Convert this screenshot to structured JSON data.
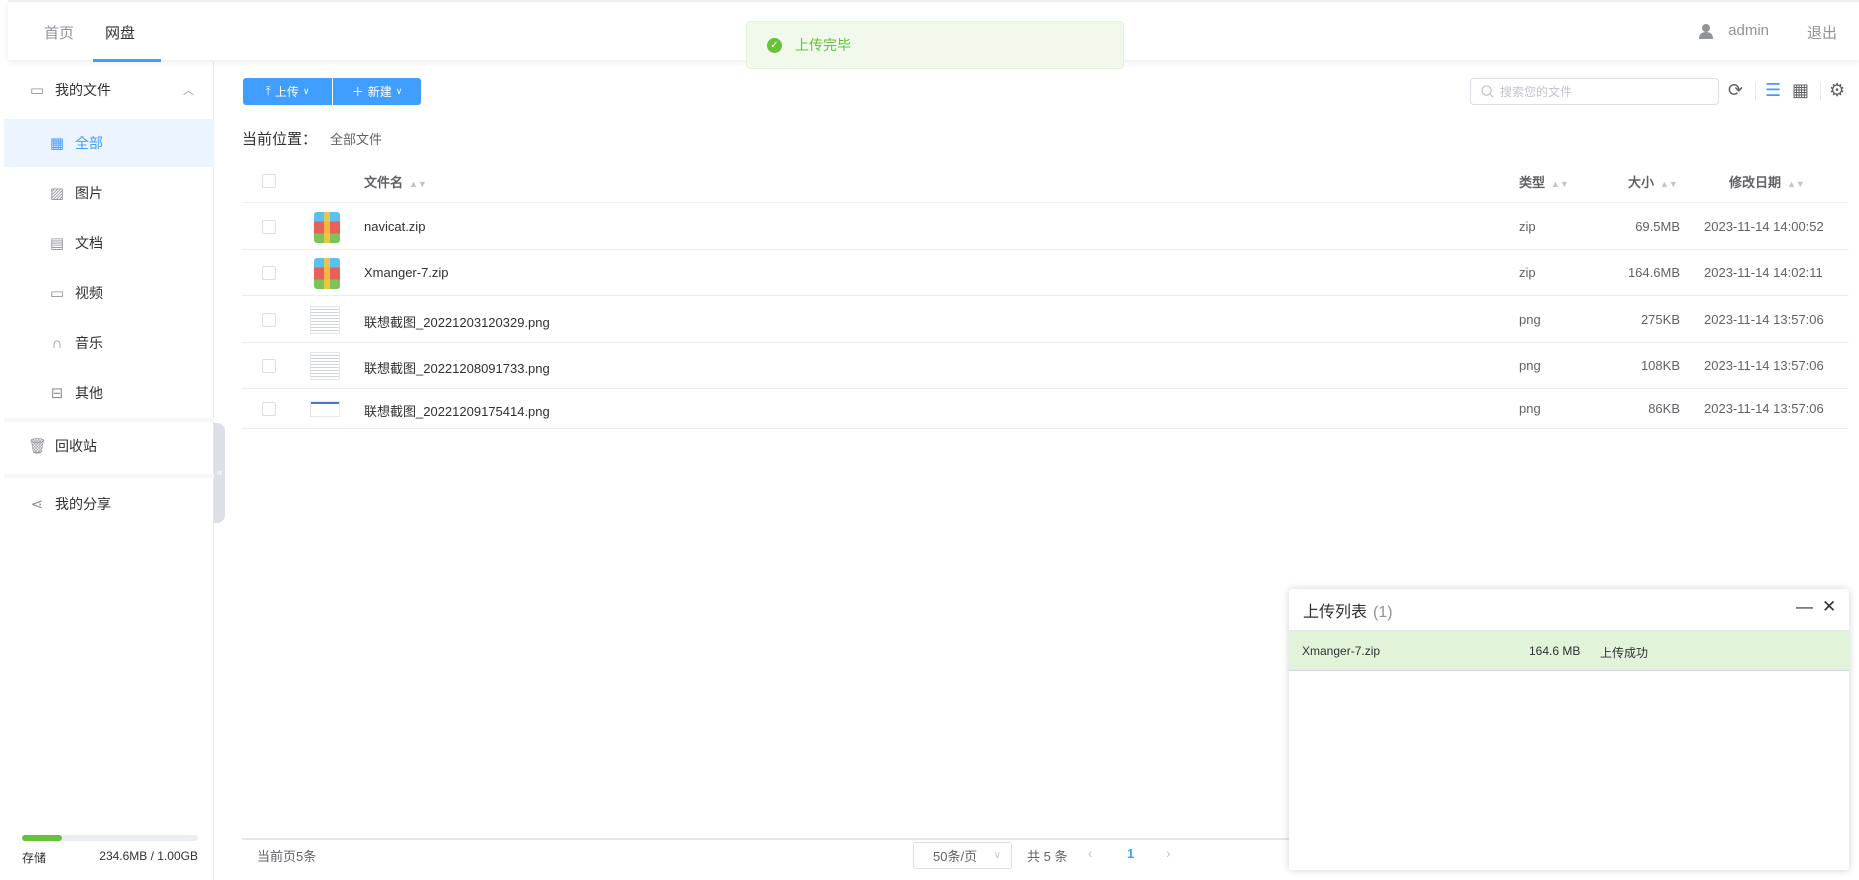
{
  "header": {
    "tabs": [
      {
        "label": "首页"
      },
      {
        "label": "网盘"
      }
    ],
    "user": "admin",
    "logout": "退出"
  },
  "toast": {
    "message": "上传完毕"
  },
  "sidebar": {
    "group": "我的文件",
    "items": [
      {
        "label": "全部",
        "icon": "grid-icon"
      },
      {
        "label": "图片",
        "icon": "image-icon"
      },
      {
        "label": "文档",
        "icon": "document-icon"
      },
      {
        "label": "视频",
        "icon": "video-icon"
      },
      {
        "label": "音乐",
        "icon": "headphones-icon"
      },
      {
        "label": "其他",
        "icon": "archive-icon"
      }
    ],
    "recycle": "回收站",
    "share": "我的分享",
    "storage": {
      "label": "存储",
      "value": "234.6MB / 1.00GB",
      "percent": 23
    }
  },
  "toolbar": {
    "upload": "上传",
    "new": "新建",
    "search_placeholder": "搜索您的文件"
  },
  "breadcrumb": {
    "label": "当前位置：",
    "path": "全部文件"
  },
  "table": {
    "columns": {
      "name": "文件名",
      "type": "类型",
      "size": "大小",
      "date": "修改日期"
    },
    "rows": [
      {
        "name": "navicat.zip",
        "type": "zip",
        "size": "69.5MB",
        "date": "2023-11-14 14:00:52",
        "thumb": "zip"
      },
      {
        "name": "Xmanger-7.zip",
        "type": "zip",
        "size": "164.6MB",
        "date": "2023-11-14 14:02:11",
        "thumb": "zip"
      },
      {
        "name": "联想截图_20221203120329.png",
        "type": "png",
        "size": "275KB",
        "date": "2023-11-14 13:57:06",
        "thumb": "image"
      },
      {
        "name": "联想截图_20221208091733.png",
        "type": "png",
        "size": "108KB",
        "date": "2023-11-14 13:57:06",
        "thumb": "image"
      },
      {
        "name": "联想截图_20221209175414.png",
        "type": "png",
        "size": "86KB",
        "date": "2023-11-14 13:57:06",
        "thumb": "image-small"
      }
    ]
  },
  "pagination": {
    "current_count": "当前页5条",
    "page_size": "50条/页",
    "total": "共 5 条",
    "page": "1"
  },
  "upload_panel": {
    "title": "上传列表",
    "count": "(1)",
    "items": [
      {
        "name": "Xmanger-7.zip",
        "size": "164.6 MB",
        "status": "上传成功"
      }
    ]
  }
}
